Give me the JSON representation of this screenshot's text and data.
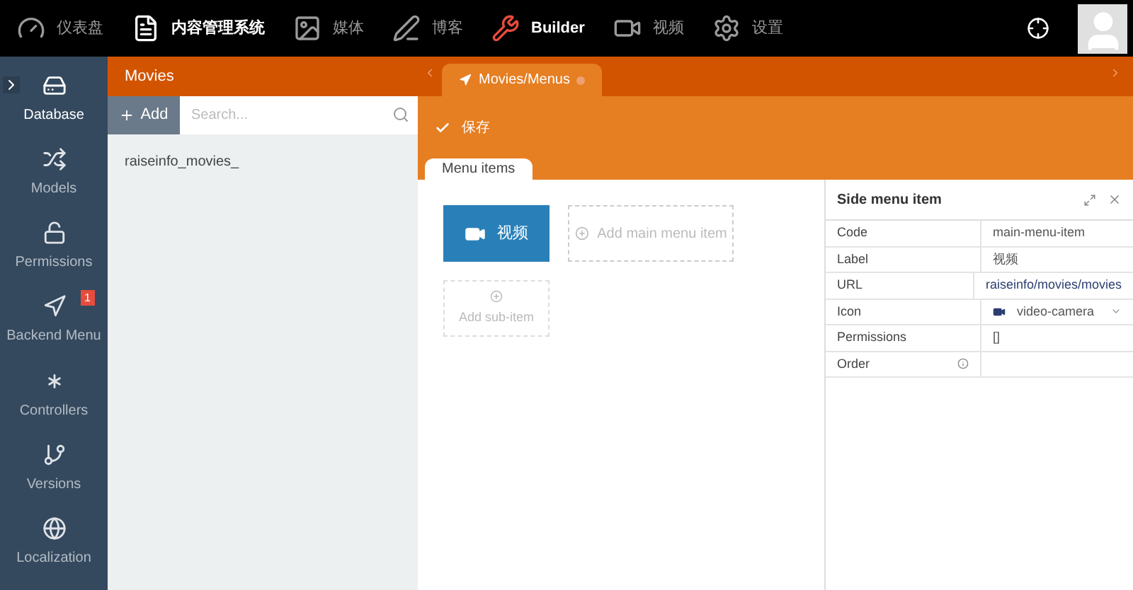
{
  "top_nav": {
    "items": [
      {
        "label": "仪表盘",
        "active": false
      },
      {
        "label": "内容管理系统",
        "active": true
      },
      {
        "label": "媒体",
        "active": false
      },
      {
        "label": "博客",
        "active": false
      },
      {
        "label": "Builder",
        "active": true
      },
      {
        "label": "视频",
        "active": false
      },
      {
        "label": "设置",
        "active": false
      }
    ]
  },
  "sidebar": {
    "items": [
      {
        "label": "Database",
        "selected": true
      },
      {
        "label": "Models",
        "selected": false
      },
      {
        "label": "Permissions",
        "selected": false
      },
      {
        "label": "Backend Menu",
        "selected": false,
        "badge": "1"
      },
      {
        "label": "Controllers",
        "selected": false
      },
      {
        "label": "Versions",
        "selected": false
      },
      {
        "label": "Localization",
        "selected": false
      }
    ]
  },
  "list_panel": {
    "title": "Movies",
    "add_button": "Add",
    "search": {
      "placeholder": "Search..."
    },
    "items": [
      "raiseinfo_movies_"
    ]
  },
  "editor": {
    "tab": "Movies/Menus",
    "save_button": "保存",
    "subtab": "Menu items",
    "menu_items": [
      {
        "label": "视频",
        "selected": true
      }
    ],
    "add_main": "Add main menu item",
    "add_sub": "Add sub-item"
  },
  "inspector": {
    "title": "Side menu item",
    "rows": [
      {
        "label": "Code",
        "value": "main-menu-item",
        "kind": "text"
      },
      {
        "label": "Label",
        "value": "视频",
        "kind": "text"
      },
      {
        "label": "URL",
        "value": "raiseinfo/movies/movies",
        "kind": "text"
      },
      {
        "label": "Icon",
        "value": "video-camera",
        "kind": "select"
      },
      {
        "label": "Permissions",
        "value": "[]",
        "kind": "text"
      },
      {
        "label": "Order",
        "value": "",
        "kind": "info"
      }
    ]
  }
}
